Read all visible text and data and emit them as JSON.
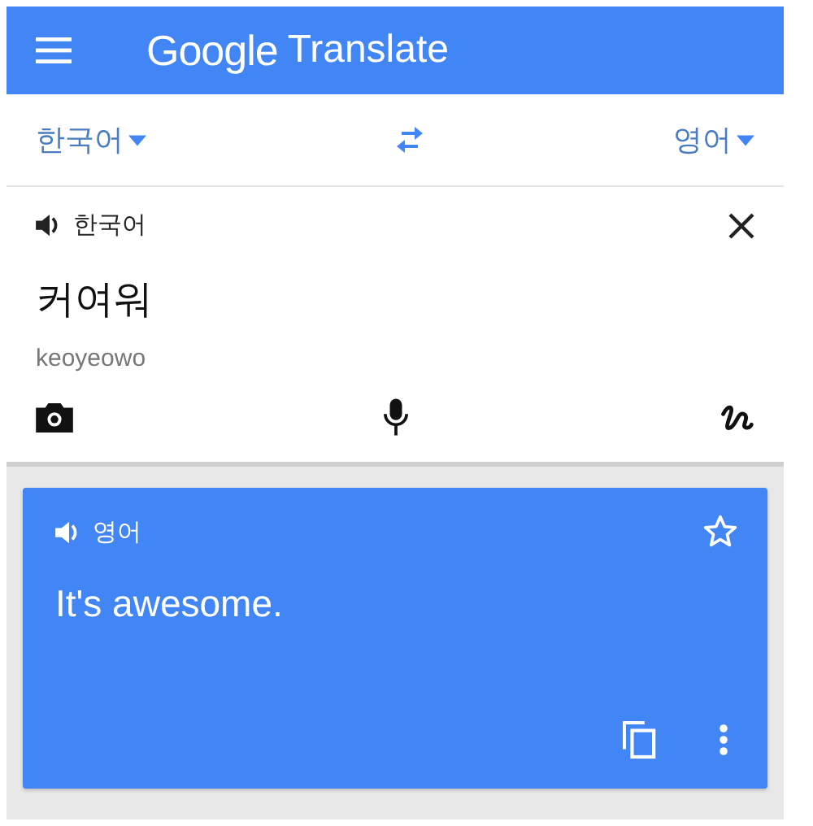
{
  "app_bar": {
    "logo": "Google",
    "title": "Translate"
  },
  "language_bar": {
    "source": "한국어",
    "target": "영어"
  },
  "input_panel": {
    "language": "한국어",
    "text": "커여워",
    "romanization": "keoyeowo"
  },
  "output_card": {
    "language": "영어",
    "text": "It's awesome.",
    "starred": false
  }
}
